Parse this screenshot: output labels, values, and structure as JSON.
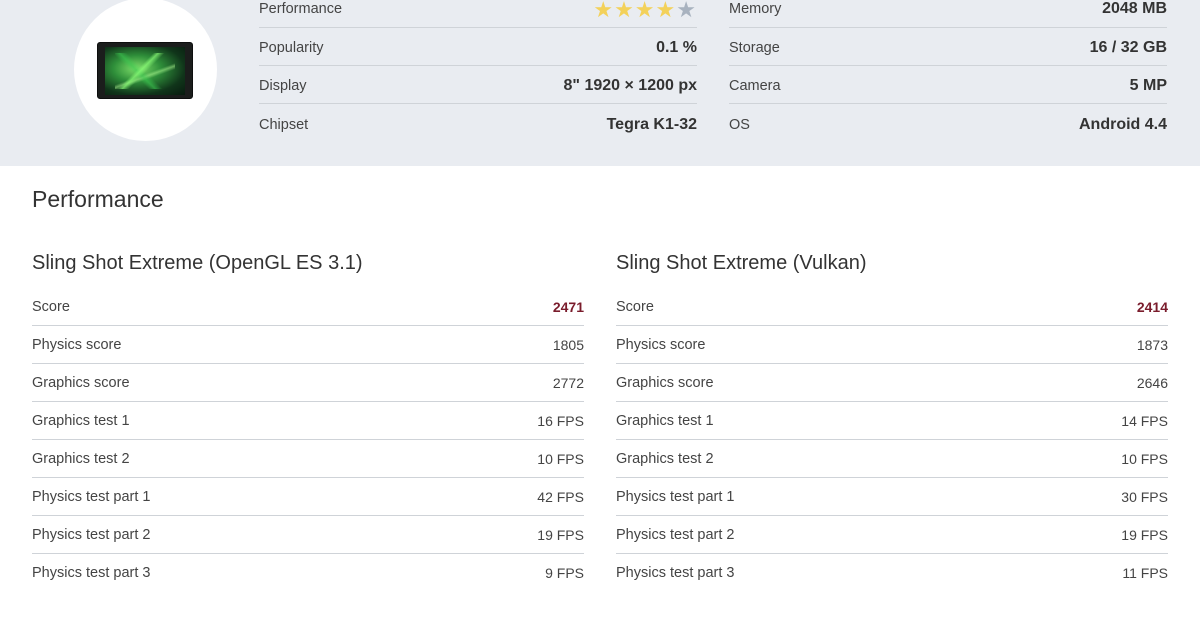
{
  "specs": {
    "left": [
      {
        "label": "Performance",
        "value": "",
        "rating": 4,
        "rating_max": 5
      },
      {
        "label": "Popularity",
        "value": "0.1 %"
      },
      {
        "label": "Display",
        "value": "8\"  1920 × 1200 px"
      },
      {
        "label": "Chipset",
        "value": "Tegra K1-32"
      }
    ],
    "right": [
      {
        "label": "Memory",
        "value": "2048 MB"
      },
      {
        "label": "Storage",
        "value": "16 / 32 GB"
      },
      {
        "label": "Camera",
        "value": "5 MP"
      },
      {
        "label": "OS",
        "value": "Android 4.4"
      }
    ]
  },
  "section_title": "Performance",
  "benchmarks": [
    {
      "title": "Sling Shot Extreme (OpenGL ES 3.1)",
      "rows": [
        {
          "label": "Score",
          "value": "2471"
        },
        {
          "label": "Physics score",
          "value": "1805"
        },
        {
          "label": "Graphics score",
          "value": "2772"
        },
        {
          "label": "Graphics test 1",
          "value": "16 FPS"
        },
        {
          "label": "Graphics test 2",
          "value": "10 FPS"
        },
        {
          "label": "Physics test part 1",
          "value": "42 FPS"
        },
        {
          "label": "Physics test part 2",
          "value": "19 FPS"
        },
        {
          "label": "Physics test part 3",
          "value": "9 FPS"
        }
      ]
    },
    {
      "title": "Sling Shot Extreme (Vulkan)",
      "rows": [
        {
          "label": "Score",
          "value": "2414"
        },
        {
          "label": "Physics score",
          "value": "1873"
        },
        {
          "label": "Graphics score",
          "value": "2646"
        },
        {
          "label": "Graphics test 1",
          "value": "14 FPS"
        },
        {
          "label": "Graphics test 2",
          "value": "10 FPS"
        },
        {
          "label": "Physics test part 1",
          "value": "30 FPS"
        },
        {
          "label": "Physics test part 2",
          "value": "19 FPS"
        },
        {
          "label": "Physics test part 3",
          "value": "11 FPS"
        }
      ]
    }
  ],
  "colors": {
    "header_bg": "#e9ecf1",
    "score_accent": "#7a1c2c",
    "star_filled": "#f3d15a",
    "star_empty": "#a8b2bf",
    "divider": "#cfd3d8"
  },
  "icons": {
    "device_image": "tablet-image",
    "rating": "star-icon"
  }
}
